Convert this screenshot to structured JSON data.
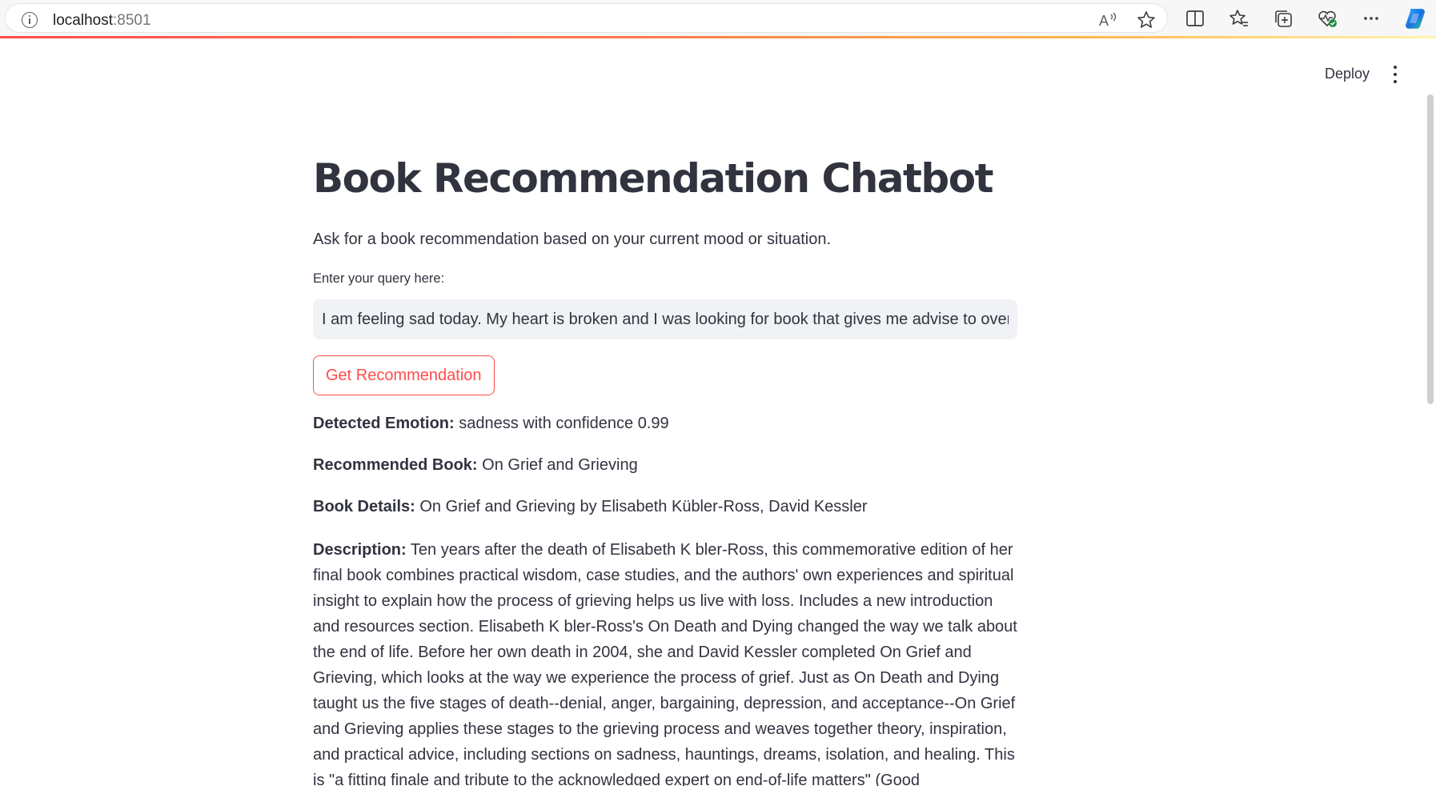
{
  "browser": {
    "url_host": "localhost",
    "url_port": ":8501",
    "icons": [
      "info-icon",
      "read-aloud-icon",
      "favorite-star-icon",
      "split-screen-icon",
      "favorites-icon",
      "collections-icon",
      "browser-essentials-icon",
      "more-icon",
      "copilot-icon"
    ]
  },
  "header": {
    "deploy_label": "Deploy"
  },
  "main": {
    "title": "Book Recommendation Chatbot",
    "subtitle": "Ask for a book recommendation based on your current mood or situation.",
    "input_label": "Enter your query here:",
    "query_value": "I am feeling sad today. My heart is broken and I was looking for book that gives me advise to overcome b",
    "button_label": "Get Recommendation",
    "results": {
      "emotion_label": "Detected Emotion:",
      "emotion_value": "sadness with confidence 0.99",
      "book_label": "Recommended Book:",
      "book_value": "On Grief and Grieving",
      "details_label": "Book Details:",
      "details_value": "On Grief and Grieving by Elisabeth Kübler-Ross, David Kessler",
      "description_label": "Description:",
      "description_value": "Ten years after the death of Elisabeth K bler-Ross, this commemorative edition of her final book combines practical wisdom, case studies, and the authors' own experiences and spiritual insight to explain how the process of grieving helps us live with loss. Includes a new introduction and resources section. Elisabeth K bler-Ross's On Death and Dying changed the way we talk about the end of life. Before her own death in 2004, she and David Kessler completed On Grief and Grieving, which looks at the way we experience the process of grief. Just as On Death and Dying taught us the five stages of death--denial, anger, bargaining, depression, and acceptance--On Grief and Grieving applies these stages to the grieving process and weaves together theory, inspiration, and practical advice, including sections on sadness, hauntings, dreams, isolation, and healing. This is \"a fitting finale and tribute to the acknowledged expert on end-of-life matters\" (Good Housekeeping)."
    }
  },
  "colors": {
    "primary": "#ff4b4b",
    "text": "#31333f",
    "input_bg": "#f0f2f6"
  }
}
